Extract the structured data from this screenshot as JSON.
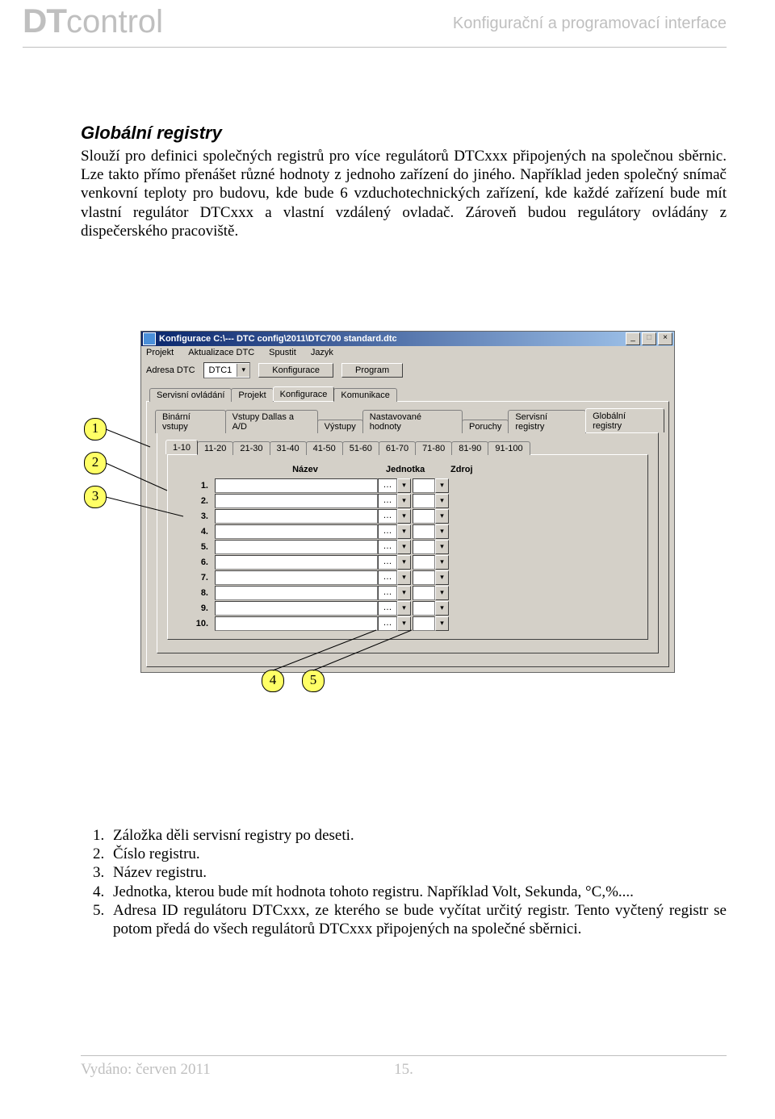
{
  "header": {
    "logo_bold": "DT",
    "logo_thin": "control",
    "slogan": "Konfigurační a programovací interface"
  },
  "section": {
    "title_main": "Globální registry",
    "paragraph": "Slouží pro definici společných registrů pro více regulátorů DTCxxx připojených na společnou sběrnic. Lze takto přímo přenášet různé hodnoty z jednoho zařízení do jiného. Například jeden společný snímač venkovní teploty pro budovu, kde bude 6 vzduchotechnických zařízení, kde každé zařízení bude mít vlastní regulátor DTCxxx a vlastní vzdálený ovladač. Zároveň budou regulátory ovládány z dispečerského pracoviště."
  },
  "win": {
    "title": "Konfigurace C:\\--- DTC config\\2011\\DTC700 standard.dtc",
    "btn_min": "_",
    "btn_max": "□",
    "btn_close": "×",
    "menu": [
      "Projekt",
      "Aktualizace DTC",
      "Spustit",
      "Jazyk"
    ],
    "addr_label": "Adresa DTC",
    "addr_value": "DTC1",
    "btn_konfigurace": "Konfigurace",
    "btn_program": "Program",
    "tabs_outer": [
      "Servisní ovládání",
      "Projekt",
      "Konfigurace",
      "Komunikace"
    ],
    "tabs_outer_sel": 2,
    "tabs_mid": [
      "Binární vstupy",
      "Vstupy Dallas a A/D",
      "Výstupy",
      "Nastavované hodnoty",
      "Poruchy",
      "Servisní registry",
      "Globální registry"
    ],
    "tabs_mid_sel": 6,
    "tabs_range": [
      "1-10",
      "11-20",
      "21-30",
      "31-40",
      "41-50",
      "51-60",
      "61-70",
      "71-80",
      "81-90",
      "91-100"
    ],
    "tabs_range_sel": 0,
    "col_name": "Název",
    "col_unit": "Jednotka",
    "col_src": "Zdroj",
    "row_numbers": [
      "1.",
      "2.",
      "3.",
      "4.",
      "5.",
      "6.",
      "7.",
      "8.",
      "9.",
      "10."
    ],
    "jn_placeholder": "…"
  },
  "callouts": [
    "1",
    "2",
    "3",
    "4",
    "5"
  ],
  "legend": [
    "Záložka děli servisní registry po deseti.",
    "Číslo registru.",
    "Název registru.",
    "Jednotka, kterou bude mít hodnota tohoto registru. Například Volt, Sekunda, °C,%....",
    "Adresa ID regulátoru DTCxxx, ze kterého se bude vyčítat určitý registr. Tento vyčtený registr se potom předá do všech regulátorů DTCxxx připojených na společné sběrnici."
  ],
  "footer": {
    "date_label": "Vydáno: ",
    "date_value": "červen 2011",
    "page": "15."
  }
}
